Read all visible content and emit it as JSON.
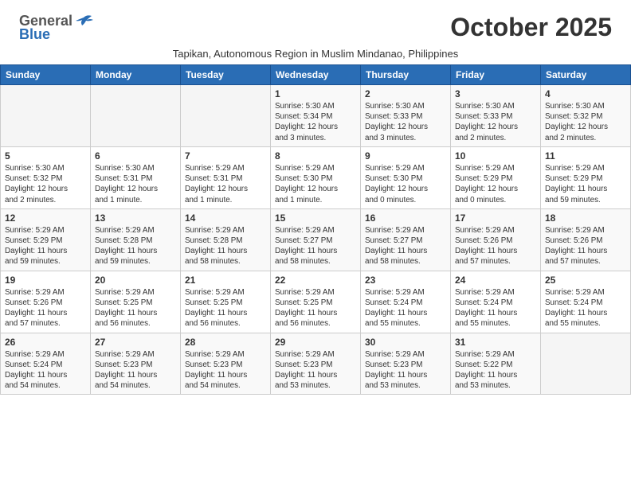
{
  "header": {
    "logo_general": "General",
    "logo_blue": "Blue",
    "month_title": "October 2025",
    "subtitle": "Tapikan, Autonomous Region in Muslim Mindanao, Philippines"
  },
  "weekdays": [
    "Sunday",
    "Monday",
    "Tuesday",
    "Wednesday",
    "Thursday",
    "Friday",
    "Saturday"
  ],
  "weeks": [
    [
      {
        "day": "",
        "info": ""
      },
      {
        "day": "",
        "info": ""
      },
      {
        "day": "",
        "info": ""
      },
      {
        "day": "1",
        "info": "Sunrise: 5:30 AM\nSunset: 5:34 PM\nDaylight: 12 hours\nand 3 minutes."
      },
      {
        "day": "2",
        "info": "Sunrise: 5:30 AM\nSunset: 5:33 PM\nDaylight: 12 hours\nand 3 minutes."
      },
      {
        "day": "3",
        "info": "Sunrise: 5:30 AM\nSunset: 5:33 PM\nDaylight: 12 hours\nand 2 minutes."
      },
      {
        "day": "4",
        "info": "Sunrise: 5:30 AM\nSunset: 5:32 PM\nDaylight: 12 hours\nand 2 minutes."
      }
    ],
    [
      {
        "day": "5",
        "info": "Sunrise: 5:30 AM\nSunset: 5:32 PM\nDaylight: 12 hours\nand 2 minutes."
      },
      {
        "day": "6",
        "info": "Sunrise: 5:30 AM\nSunset: 5:31 PM\nDaylight: 12 hours\nand 1 minute."
      },
      {
        "day": "7",
        "info": "Sunrise: 5:29 AM\nSunset: 5:31 PM\nDaylight: 12 hours\nand 1 minute."
      },
      {
        "day": "8",
        "info": "Sunrise: 5:29 AM\nSunset: 5:30 PM\nDaylight: 12 hours\nand 1 minute."
      },
      {
        "day": "9",
        "info": "Sunrise: 5:29 AM\nSunset: 5:30 PM\nDaylight: 12 hours\nand 0 minutes."
      },
      {
        "day": "10",
        "info": "Sunrise: 5:29 AM\nSunset: 5:29 PM\nDaylight: 12 hours\nand 0 minutes."
      },
      {
        "day": "11",
        "info": "Sunrise: 5:29 AM\nSunset: 5:29 PM\nDaylight: 11 hours\nand 59 minutes."
      }
    ],
    [
      {
        "day": "12",
        "info": "Sunrise: 5:29 AM\nSunset: 5:29 PM\nDaylight: 11 hours\nand 59 minutes."
      },
      {
        "day": "13",
        "info": "Sunrise: 5:29 AM\nSunset: 5:28 PM\nDaylight: 11 hours\nand 59 minutes."
      },
      {
        "day": "14",
        "info": "Sunrise: 5:29 AM\nSunset: 5:28 PM\nDaylight: 11 hours\nand 58 minutes."
      },
      {
        "day": "15",
        "info": "Sunrise: 5:29 AM\nSunset: 5:27 PM\nDaylight: 11 hours\nand 58 minutes."
      },
      {
        "day": "16",
        "info": "Sunrise: 5:29 AM\nSunset: 5:27 PM\nDaylight: 11 hours\nand 58 minutes."
      },
      {
        "day": "17",
        "info": "Sunrise: 5:29 AM\nSunset: 5:26 PM\nDaylight: 11 hours\nand 57 minutes."
      },
      {
        "day": "18",
        "info": "Sunrise: 5:29 AM\nSunset: 5:26 PM\nDaylight: 11 hours\nand 57 minutes."
      }
    ],
    [
      {
        "day": "19",
        "info": "Sunrise: 5:29 AM\nSunset: 5:26 PM\nDaylight: 11 hours\nand 57 minutes."
      },
      {
        "day": "20",
        "info": "Sunrise: 5:29 AM\nSunset: 5:25 PM\nDaylight: 11 hours\nand 56 minutes."
      },
      {
        "day": "21",
        "info": "Sunrise: 5:29 AM\nSunset: 5:25 PM\nDaylight: 11 hours\nand 56 minutes."
      },
      {
        "day": "22",
        "info": "Sunrise: 5:29 AM\nSunset: 5:25 PM\nDaylight: 11 hours\nand 56 minutes."
      },
      {
        "day": "23",
        "info": "Sunrise: 5:29 AM\nSunset: 5:24 PM\nDaylight: 11 hours\nand 55 minutes."
      },
      {
        "day": "24",
        "info": "Sunrise: 5:29 AM\nSunset: 5:24 PM\nDaylight: 11 hours\nand 55 minutes."
      },
      {
        "day": "25",
        "info": "Sunrise: 5:29 AM\nSunset: 5:24 PM\nDaylight: 11 hours\nand 55 minutes."
      }
    ],
    [
      {
        "day": "26",
        "info": "Sunrise: 5:29 AM\nSunset: 5:24 PM\nDaylight: 11 hours\nand 54 minutes."
      },
      {
        "day": "27",
        "info": "Sunrise: 5:29 AM\nSunset: 5:23 PM\nDaylight: 11 hours\nand 54 minutes."
      },
      {
        "day": "28",
        "info": "Sunrise: 5:29 AM\nSunset: 5:23 PM\nDaylight: 11 hours\nand 54 minutes."
      },
      {
        "day": "29",
        "info": "Sunrise: 5:29 AM\nSunset: 5:23 PM\nDaylight: 11 hours\nand 53 minutes."
      },
      {
        "day": "30",
        "info": "Sunrise: 5:29 AM\nSunset: 5:23 PM\nDaylight: 11 hours\nand 53 minutes."
      },
      {
        "day": "31",
        "info": "Sunrise: 5:29 AM\nSunset: 5:22 PM\nDaylight: 11 hours\nand 53 minutes."
      },
      {
        "day": "",
        "info": ""
      }
    ]
  ]
}
